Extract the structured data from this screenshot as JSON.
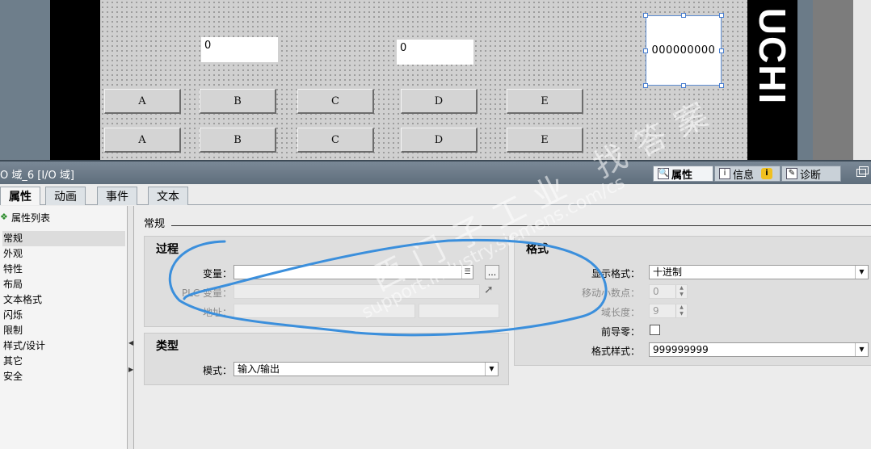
{
  "hmi": {
    "io_fields": [
      {
        "id": "io1",
        "value": "0"
      },
      {
        "id": "io2",
        "value": "0"
      },
      {
        "id": "io_selected",
        "value": "000000000"
      }
    ],
    "buttons_row1": [
      "A",
      "B",
      "C",
      "D",
      "E"
    ],
    "buttons_row2": [
      "A",
      "B",
      "C",
      "D",
      "E"
    ],
    "brand_text": "UCHI"
  },
  "inspector": {
    "title": "O 域_6 [I/O 域]",
    "tabs": {
      "properties": "属性",
      "info": "信息",
      "diagnostics": "诊断"
    }
  },
  "main_tabs": [
    "属性",
    "动画",
    "事件",
    "文本"
  ],
  "nav": {
    "header": "属性列表",
    "items": [
      "常规",
      "外观",
      "特性",
      "布局",
      "文本格式",
      "闪烁",
      "限制",
      "样式/设计",
      "其它",
      "安全"
    ],
    "selected_index": 0
  },
  "content": {
    "section_title": "常规",
    "process": {
      "title": "过程",
      "variable_label": "变量：",
      "variable_value": "",
      "plc_variable_label": "PLC 变量：",
      "address_label": "地址：",
      "browse_label": "..."
    },
    "type": {
      "title": "类型",
      "mode_label": "模式：",
      "mode_value": "输入/输出"
    },
    "format": {
      "title": "格式",
      "display_format_label": "显示格式：",
      "display_format_value": "十进制",
      "decimal_places_label": "移动小数点：",
      "decimal_places_value": "0",
      "field_length_label": "域长度：",
      "field_length_value": "9",
      "leading_zeros_label": "前导零：",
      "leading_zeros_checked": false,
      "format_pattern_label": "格式样式：",
      "format_pattern_value": "999999999"
    }
  },
  "watermark": {
    "chinese": "西门子工业 找答案",
    "url": "support.industry.siemens.com/cs"
  },
  "colors": {
    "annotation_stroke": "#3b8fdc",
    "canvas_bg": "#d0d0d0",
    "inspector_bar": "#6b7a88"
  }
}
